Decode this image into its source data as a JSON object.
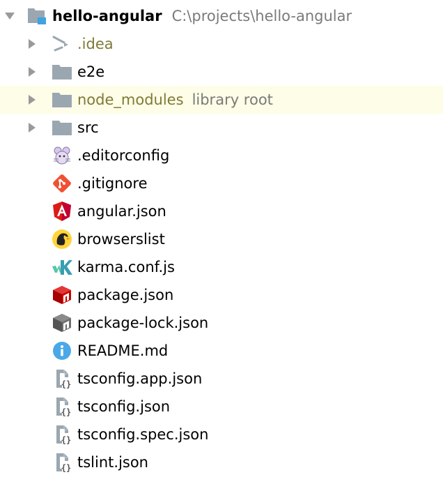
{
  "project": {
    "name": "hello-angular",
    "path": "C:\\projects\\hello-angular"
  },
  "folders": [
    {
      "label": ".idea"
    },
    {
      "label": "e2e"
    },
    {
      "label": "node_modules",
      "hint": "library root"
    },
    {
      "label": "src"
    }
  ],
  "files": [
    {
      "label": ".editorconfig",
      "icon": "editorconfig-icon"
    },
    {
      "label": ".gitignore",
      "icon": "git-icon"
    },
    {
      "label": "angular.json",
      "icon": "angular-icon"
    },
    {
      "label": "browserslist",
      "icon": "browserslist-icon"
    },
    {
      "label": "karma.conf.js",
      "icon": "karma-icon"
    },
    {
      "label": "package.json",
      "icon": "npm-icon"
    },
    {
      "label": "package-lock.json",
      "icon": "npm-lock-icon"
    },
    {
      "label": "README.md",
      "icon": "info-icon"
    },
    {
      "label": "tsconfig.app.json",
      "icon": "json-file-icon"
    },
    {
      "label": "tsconfig.json",
      "icon": "json-file-icon"
    },
    {
      "label": "tsconfig.spec.json",
      "icon": "json-file-icon"
    },
    {
      "label": "tslint.json",
      "icon": "json-file-icon"
    }
  ],
  "colors": {
    "highlight_row": "#fefde7",
    "folder": "#9aa7b0",
    "excluded_text": "#7f7a38",
    "hint_text": "#7a7a7a"
  }
}
